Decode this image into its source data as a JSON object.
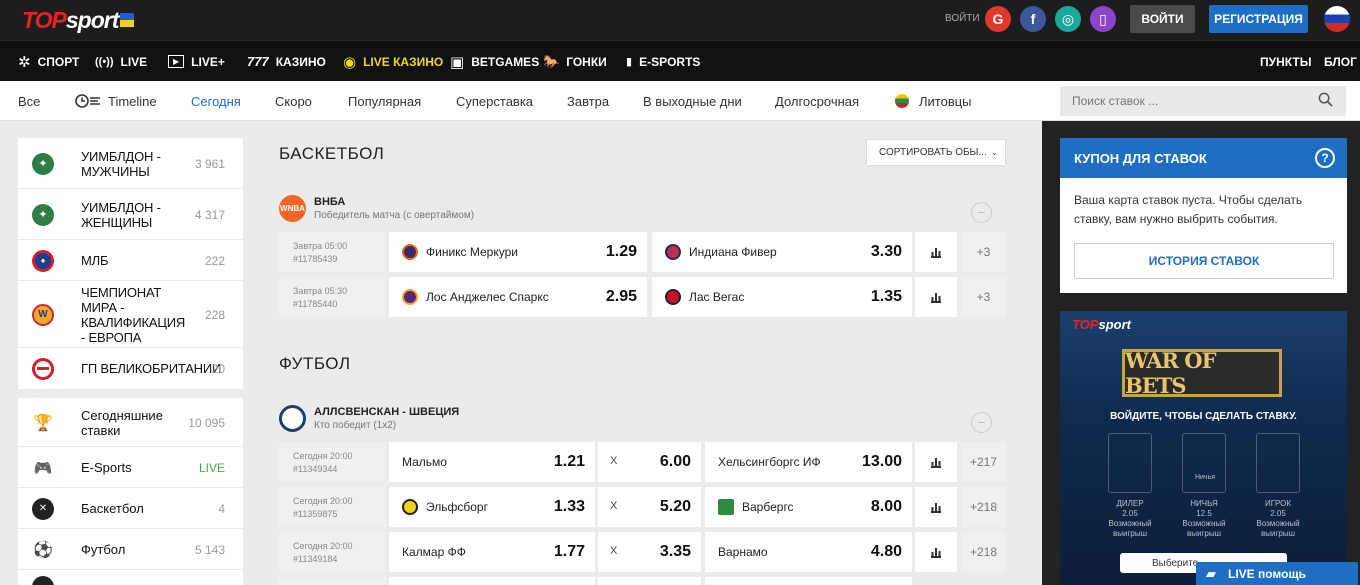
{
  "header": {
    "logo_top": "TOP",
    "logo_sport": "sport",
    "login_label": "ВОЙТИ",
    "login_button": "ВОЙТИ",
    "register_button": "РЕГИСТРАЦИЯ",
    "social": [
      {
        "name": "google-icon",
        "glyph": "G",
        "color": "#e0392b"
      },
      {
        "name": "facebook-icon",
        "glyph": "f",
        "color": "#3b5998"
      },
      {
        "name": "diia-icon",
        "glyph": "◎",
        "color": "#1aa89c"
      },
      {
        "name": "phone-icon",
        "glyph": "▯",
        "color": "#8e44c9"
      }
    ]
  },
  "mainnav": {
    "items": [
      {
        "label": "СПОРТ",
        "icon": "✲"
      },
      {
        "label": "LIVE",
        "icon": "((•))"
      },
      {
        "label": "LIVE+",
        "icon": "▶"
      },
      {
        "label": "КАЗИНО",
        "icon": "777"
      },
      {
        "label": "LIVE КАЗИНО",
        "icon": "◉"
      },
      {
        "label": "BETGAMES",
        "icon": "▣"
      },
      {
        "label": "ГОНКИ",
        "icon": "🐎"
      },
      {
        "label": "E-SPORTS",
        "icon": "▮"
      }
    ],
    "right": [
      {
        "label": "ПУНКТЫ"
      },
      {
        "label": "БЛОГ"
      }
    ]
  },
  "subnav": {
    "items": [
      {
        "label": "Все"
      },
      {
        "label": "Timeline"
      },
      {
        "label": "Сегодня"
      },
      {
        "label": "Скоро"
      },
      {
        "label": "Популярная"
      },
      {
        "label": "Суперставка"
      },
      {
        "label": "Завтра"
      },
      {
        "label": "В выходные дни"
      },
      {
        "label": "Долгосрочная"
      },
      {
        "label": "Литовцы"
      }
    ],
    "search_placeholder": "Поиск ставок ..."
  },
  "sidebar": {
    "top_items": [
      {
        "label": "УИМБЛДОН - МУЖЧИНЫ",
        "count": "3 961"
      },
      {
        "label": "УИМБЛДОН - ЖЕНЩИНЫ",
        "count": "4 317"
      },
      {
        "label": "МЛБ",
        "count": "222"
      },
      {
        "label": "ЧЕМПИОНАТ МИРА - КВАЛИФИКАЦИЯ - ЕВРОПА",
        "count": "228"
      },
      {
        "label": "ГП ВЕЛИКОБРИТАНИИ",
        "count": "20"
      }
    ],
    "sport_items": [
      {
        "label": "Сегодняшние ставки",
        "count": "10 095"
      },
      {
        "label": "E-Sports",
        "count": "LIVE"
      },
      {
        "label": "Баскетбол",
        "count": "4"
      },
      {
        "label": "Футбол",
        "count": "5 143"
      }
    ]
  },
  "center": {
    "sort_label": "СОРТИРОВАТЬ ОБЫ...",
    "basketball": {
      "title": "БАСКЕТБОЛ",
      "league": "ВНБА",
      "market": "Победитель матча (с овертаймом)",
      "matches": [
        {
          "time": "Завтра 05:00",
          "id": "#11785439",
          "home": "Финикс Меркури",
          "home_odd": "1.29",
          "away": "Индиана Фивер",
          "away_odd": "3.30",
          "more": "+3"
        },
        {
          "time": "Завтра 05:30",
          "id": "#11785440",
          "home": "Лос Анджелес Спаркс",
          "home_odd": "2.95",
          "away": "Лас Вегас",
          "away_odd": "1.35",
          "more": "+3"
        }
      ]
    },
    "football": {
      "title": "ФУТБОЛ",
      "league": "АЛЛСВЕНСКАН - ШВЕЦИЯ",
      "market": "Кто победит (1x2)",
      "matches": [
        {
          "time": "Сегодня 20:00",
          "id": "#11349344",
          "home": "Мальмо",
          "home_odd": "1.21",
          "draw_label": "X",
          "draw_odd": "6.00",
          "away": "Хельсингборгс ИФ",
          "away_odd": "13.00",
          "more": "+217"
        },
        {
          "time": "Сегодня 20:00",
          "id": "#11359875",
          "home": "Эльфсборг",
          "home_odd": "1.33",
          "draw_label": "X",
          "draw_odd": "5.20",
          "away": "Варбергс",
          "away_odd": "8.00",
          "more": "+218"
        },
        {
          "time": "Сегодня 20:00",
          "id": "#11349184",
          "home": "Калмар ФФ",
          "home_odd": "1.77",
          "draw_label": "X",
          "draw_odd": "3.35",
          "away": "Варнамо",
          "away_odd": "4.80",
          "more": "+218"
        }
      ]
    }
  },
  "coupon": {
    "title": "КУПОН ДЛЯ СТАВОК",
    "empty_text": "Ваша карта ставок пуста. Чтобы сделать ставку, вам нужно выбрить события.",
    "history_button": "ИСТОРИЯ СТАВОК"
  },
  "banner": {
    "logo": "TOPsport",
    "title": "WAR OF BETS",
    "cta": "ВОЙДИТЕ, ЧТОБЫ СДЕЛАТЬ СТАВКУ.",
    "slots": [
      {
        "label": "ДИЛЕР",
        "value": "2.05"
      },
      {
        "label": "НИЧЬЯ",
        "value": "12.5"
      },
      {
        "label": "ИГРОК",
        "value": "2.05"
      }
    ],
    "slot_note": "Возможный выигрыш",
    "draw_slot_label": "Ничья",
    "button": "Выберите..."
  },
  "live_help": "LIVE помощь"
}
